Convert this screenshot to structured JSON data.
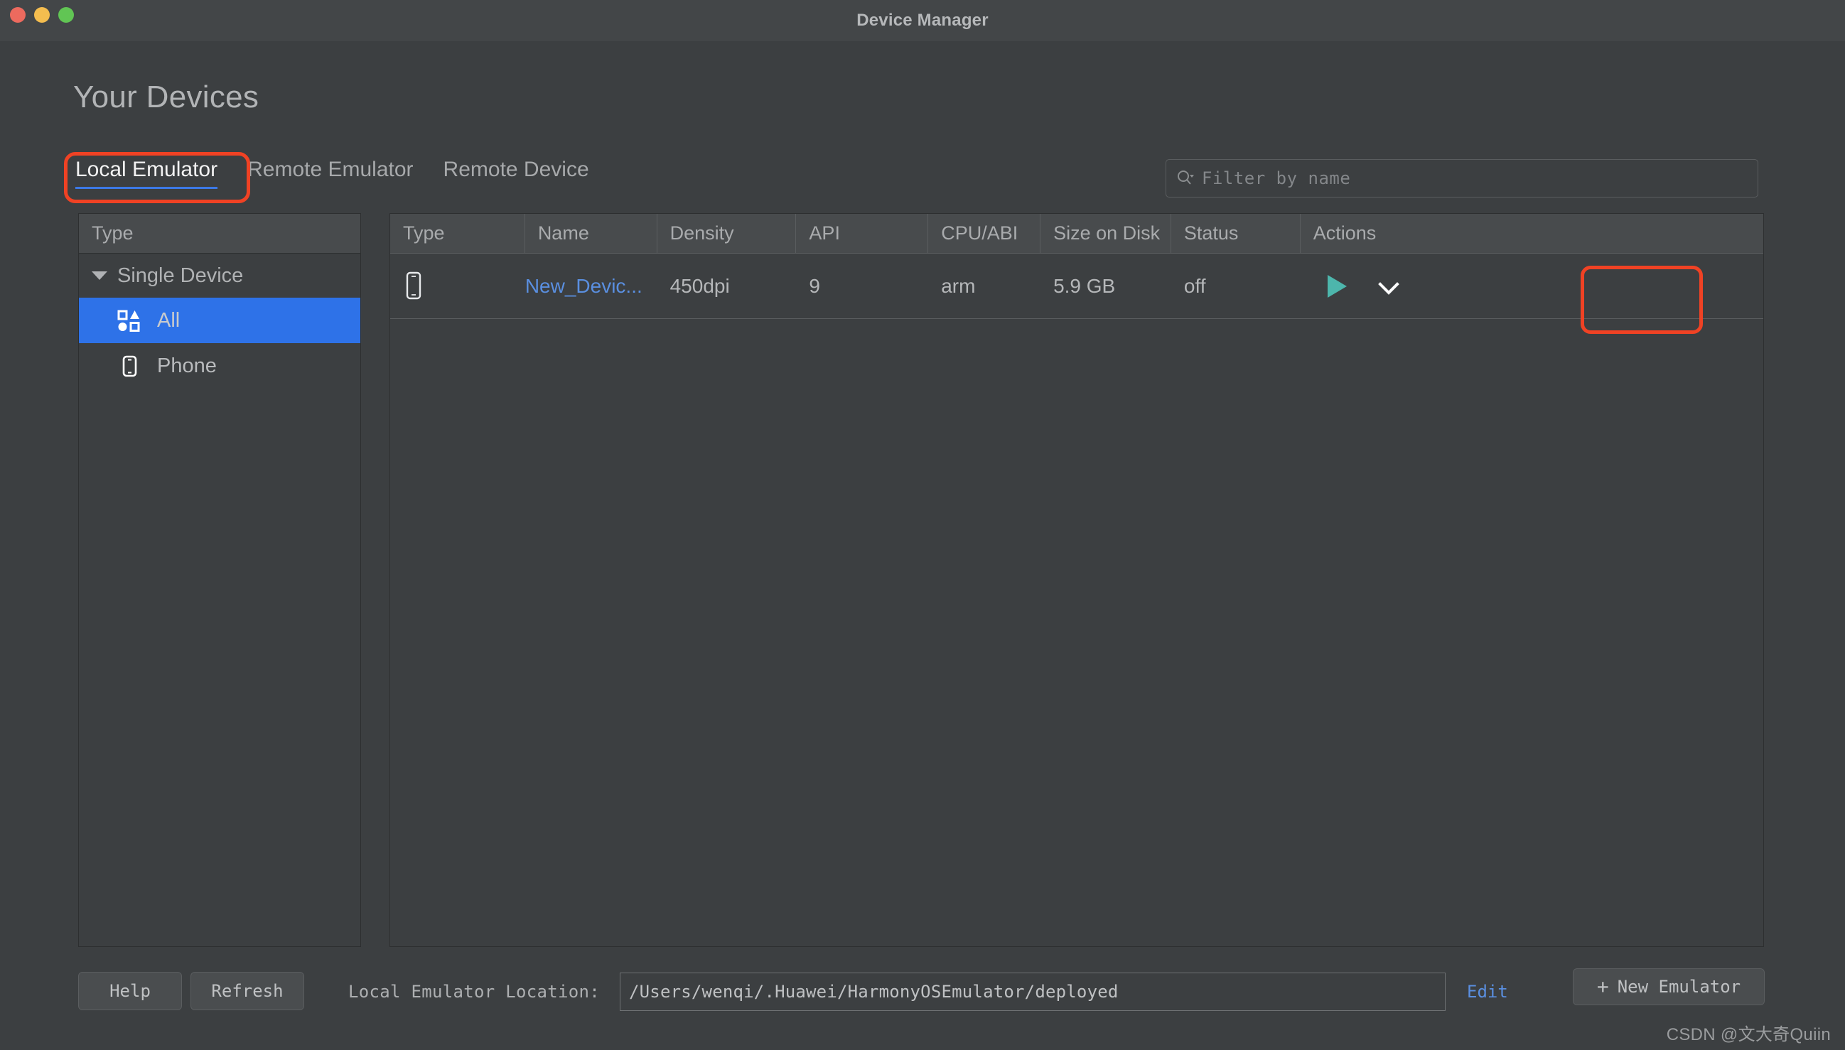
{
  "window": {
    "title": "Device Manager",
    "traffic_lights": [
      "close",
      "minimize",
      "maximize"
    ]
  },
  "page": {
    "heading": "Your Devices"
  },
  "tabs": [
    {
      "label": "Local Emulator",
      "active": true
    },
    {
      "label": "Remote Emulator",
      "active": false
    },
    {
      "label": "Remote Device",
      "active": false
    }
  ],
  "search": {
    "placeholder": "Filter by name",
    "value": "",
    "icon": "search-icon"
  },
  "sidebar": {
    "header": "Type",
    "group": {
      "label": "Single Device",
      "expanded": true
    },
    "items": [
      {
        "label": "All",
        "icon": "shapes-icon",
        "selected": true
      },
      {
        "label": "Phone",
        "icon": "phone-icon",
        "selected": false
      }
    ]
  },
  "table": {
    "columns": [
      "Type",
      "Name",
      "Density",
      "API",
      "CPU/ABI",
      "Size on Disk",
      "Status",
      "Actions"
    ],
    "rows": [
      {
        "type_icon": "phone-icon",
        "name": "New_Devic...",
        "density": "450dpi",
        "api": "9",
        "cpu_abi": "arm",
        "size_on_disk": "5.9 GB",
        "status": "off",
        "actions": [
          "play-icon",
          "chevron-down-icon"
        ]
      }
    ]
  },
  "footer": {
    "help_label": "Help",
    "refresh_label": "Refresh",
    "location_label": "Local Emulator Location:",
    "location_value": "/Users/wenqi/.Huawei/HarmonyOSEmulator/deployed",
    "edit_label": "Edit",
    "new_emulator_label": "New Emulator",
    "new_emulator_plus": "+"
  },
  "watermark": "CSDN @文大奇Quiin",
  "colors": {
    "background": "#3C3F41",
    "header_row": "#484B4D",
    "accent_blue": "#2E72E8",
    "link_blue": "#5A8FE0",
    "annotation_red": "#F04224",
    "play_teal": "#4DB6AC"
  }
}
